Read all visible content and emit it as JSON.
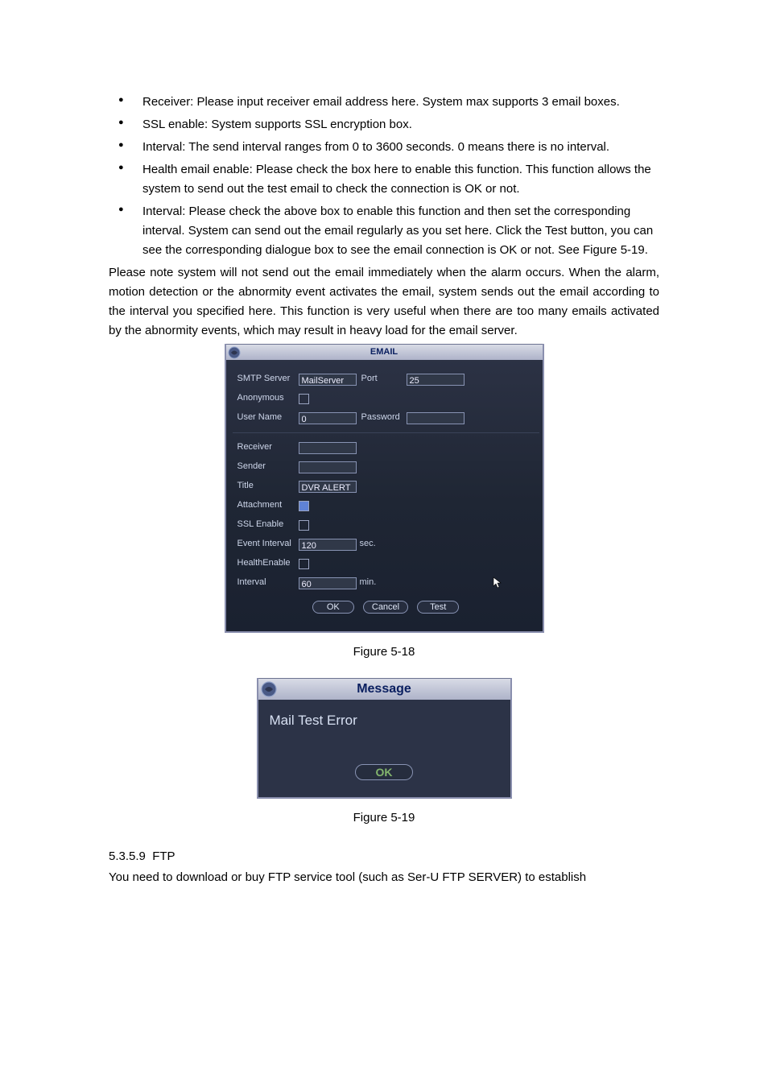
{
  "bullets": {
    "b1": "Receiver: Please input receiver email address here. System max supports 3 email boxes.",
    "b2": "SSL enable: System supports SSL encryption box.",
    "b3": "Interval: The send interval ranges from 0 to 3600 seconds. 0 means there is no interval.",
    "b4": "Health email enable: Please check the box here to enable this function. This function allows the system to send out the test email to check the connection is OK or not.",
    "b5": "Interval: Please check the above box to enable this function and then set the corresponding interval. System can send out the email regularly as you set here. Click the Test button, you can see the corresponding dialogue box to see the email connection is OK or not.    See Figure 5-19."
  },
  "para": {
    "p1": "Please note system will not send out the email immediately when the alarm occurs. When the alarm, motion detection or the abnormity event activates the email, system sends out the email according to the interval you specified here. This function is very useful when there are too many emails activated by the abnormity events, which may result in heavy load for the email server."
  },
  "ui1": {
    "title": "EMAIL",
    "labels": {
      "smtp": "SMTP Server",
      "port": "Port",
      "anon": "Anonymous",
      "user": "User Name",
      "pass": "Password",
      "receiver": "Receiver",
      "sender": "Sender",
      "titleLab": "Title",
      "attach": "Attachment",
      "ssl": "SSL Enable",
      "evint": "Event Interval",
      "health": "HealthEnable",
      "interval": "Interval"
    },
    "values": {
      "smtp": "MailServer",
      "port": "25",
      "user": "0",
      "pass": "",
      "receiver": "",
      "sender": "",
      "title": "DVR ALERT",
      "evint": "120",
      "interval": "60"
    },
    "suffix": {
      "sec": "sec.",
      "min": "min."
    },
    "buttons": {
      "ok": "OK",
      "cancel": "Cancel",
      "test": "Test"
    }
  },
  "fig1": "Figure 5-18",
  "ui2": {
    "title": "Message",
    "msg": "Mail Test Error",
    "ok": "OK"
  },
  "fig2": "Figure 5-19",
  "section": {
    "num": "5.3.5.9",
    "title": "FTP",
    "body": "You need to download or buy FTP service tool (such as Ser-U FTP SERVER) to establish"
  }
}
